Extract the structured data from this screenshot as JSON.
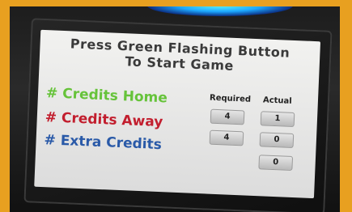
{
  "screen": {
    "title_line1": "Press Green Flashing Button",
    "title_line2": "To Start Game",
    "credits": {
      "home_label": "# Credits Home",
      "away_label": "# Credits Away",
      "extra_label": "# Extra Credits"
    },
    "columns": {
      "required": "Required",
      "actual": "Actual"
    },
    "values": {
      "home_required": "4",
      "home_actual": "1",
      "away_required": "4",
      "away_actual": "0",
      "extra_actual": "0"
    }
  },
  "colors": {
    "background": "#e8a020",
    "home": "#66c33a",
    "away": "#c21e2e",
    "extra": "#2a5aa8",
    "glow": "#1ca8ff"
  }
}
